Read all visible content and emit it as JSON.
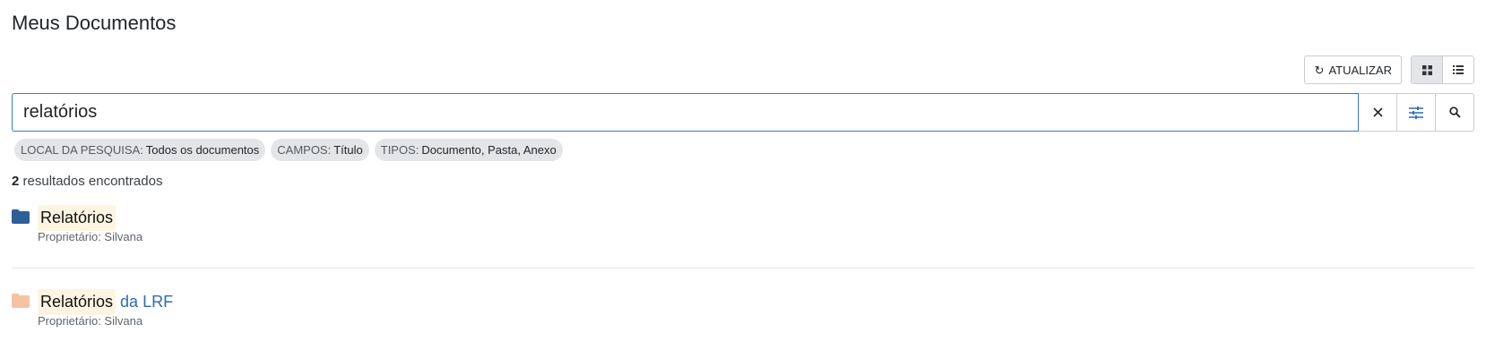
{
  "page": {
    "title": "Meus Documentos"
  },
  "toolbar": {
    "refresh_label": "ATUALIZAR",
    "refresh_icon": "refresh-icon",
    "view_modes": [
      "grid-view-icon",
      "list-view-icon"
    ],
    "active_view": "grid"
  },
  "search": {
    "value": "relatórios",
    "clear_icon": "close-icon",
    "filters_icon": "sliders-icon",
    "search_icon": "search-icon"
  },
  "chips": [
    {
      "key": "LOCAL DA PESQUISA:",
      "value": "Todos os documentos"
    },
    {
      "key": "CAMPOS:",
      "value": "Título"
    },
    {
      "key": "TIPOS:",
      "value": "Documento, Pasta, Anexo"
    }
  ],
  "results": {
    "count": "2",
    "label": "resultados encontrados",
    "items": [
      {
        "highlight": "Relatórios",
        "tail": "",
        "owner": "Proprietário: Silvana",
        "icon": "folder-icon",
        "icon_color": "#2e5f99"
      },
      {
        "highlight": "Relatórios",
        "tail": "da LRF",
        "owner": "Proprietário: Silvana",
        "icon": "folder-icon",
        "icon_color": "#f5c3a2"
      }
    ]
  },
  "colors": {
    "accent": "#3a7bbf",
    "link": "#2b6cb0",
    "highlight_bg": "#fdf5e1"
  }
}
